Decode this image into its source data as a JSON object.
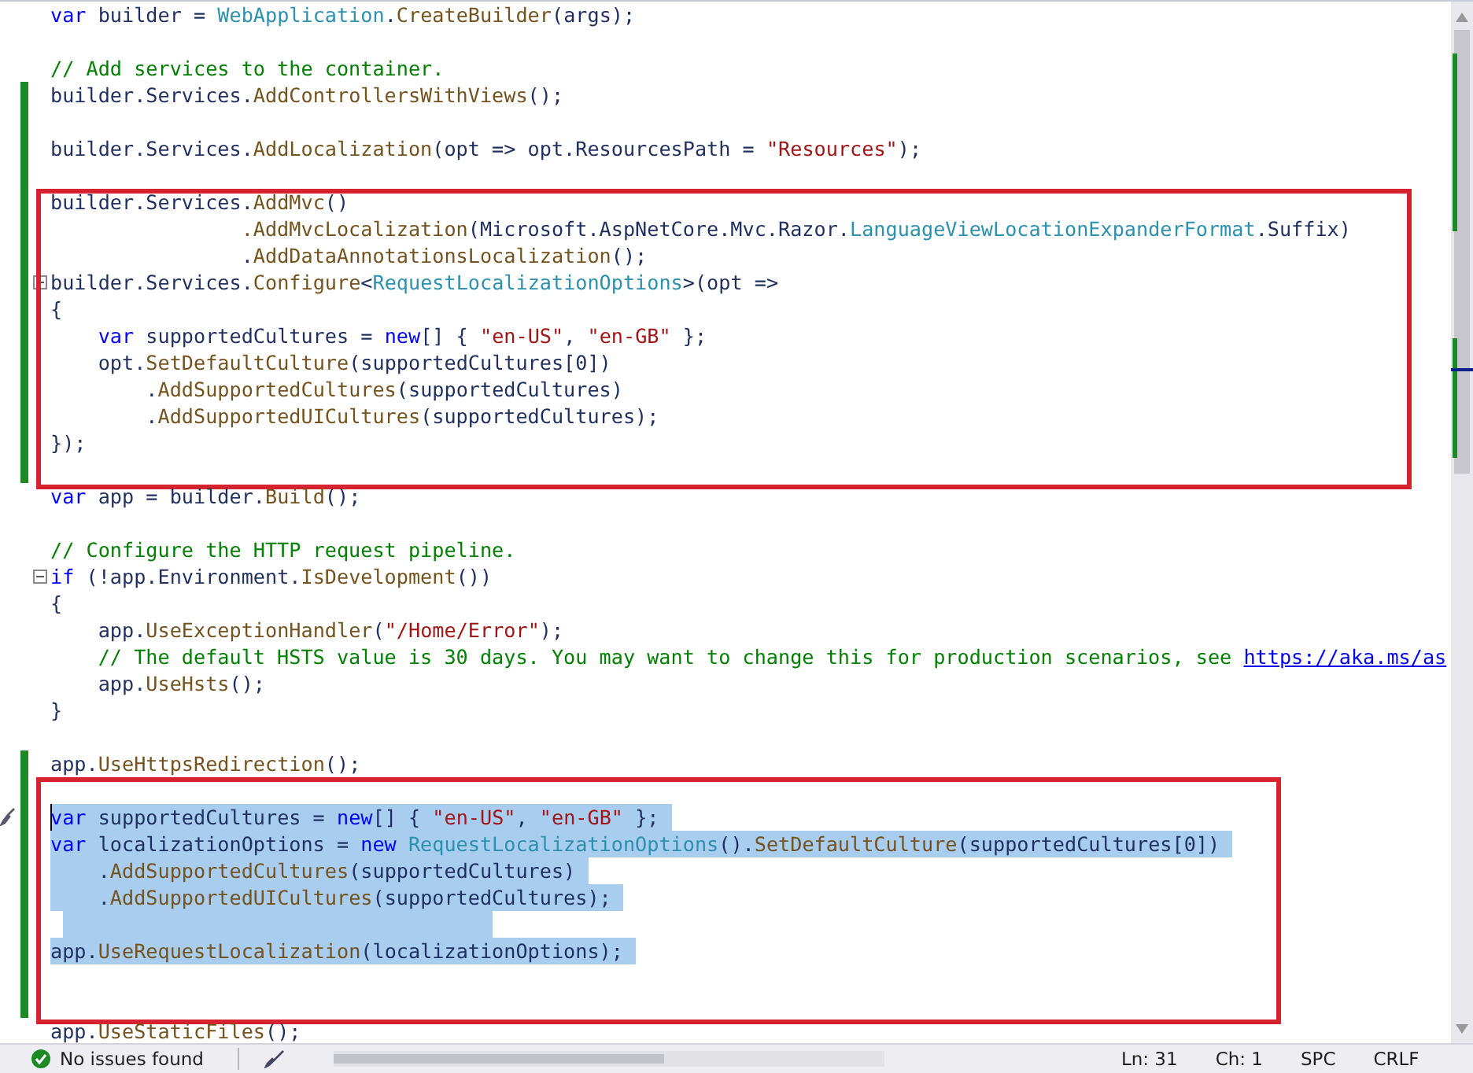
{
  "editor": {
    "blocks": [
      {
        "kind": "plain",
        "lines": [
          {
            "changed": false,
            "selected": false,
            "tokens": [
              {
                "kind": "keyword",
                "text": "var"
              },
              {
                "kind": "plain",
                "text": " builder = "
              },
              {
                "kind": "type",
                "text": "WebApplication"
              },
              {
                "kind": "plain",
                "text": "."
              },
              {
                "kind": "method",
                "text": "CreateBuilder"
              },
              {
                "kind": "plain",
                "text": "(args);"
              }
            ]
          },
          {
            "changed": false,
            "selected": false
          },
          {
            "changed": false,
            "selected": false,
            "tokens": [
              {
                "kind": "comment",
                "text": "// Add services to the container."
              }
            ]
          },
          {
            "changed": true,
            "selected": false,
            "tokens": [
              {
                "kind": "plain",
                "text": "builder.Services."
              },
              {
                "kind": "method",
                "text": "AddControllersWithViews"
              },
              {
                "kind": "plain",
                "text": "();"
              }
            ]
          },
          {
            "changed": true,
            "selected": false
          },
          {
            "changed": true,
            "selected": false,
            "tokens": [
              {
                "kind": "plain",
                "text": "builder.Services."
              },
              {
                "kind": "method",
                "text": "AddLocalization"
              },
              {
                "kind": "plain",
                "text": "(opt => opt.ResourcesPath = "
              },
              {
                "kind": "string",
                "text": "\"Resources\""
              },
              {
                "kind": "plain",
                "text": ");"
              }
            ]
          },
          {
            "changed": true,
            "selected": false
          }
        ]
      },
      {
        "kind": "annotated",
        "lines": [
          {
            "changed": true,
            "selected": false,
            "tokens": [
              {
                "kind": "plain",
                "text": "builder.Services."
              },
              {
                "kind": "method",
                "text": "AddMvc"
              },
              {
                "kind": "plain",
                "text": "()"
              }
            ]
          },
          {
            "changed": true,
            "selected": false,
            "tokens": [
              {
                "kind": "method",
                "text": "                .AddMvcLocalization"
              },
              {
                "kind": "plain",
                "text": "(Microsoft.AspNetCore.Mvc.Razor."
              },
              {
                "kind": "type",
                "text": "LanguageViewLocationExpanderFormat"
              },
              {
                "kind": "plain",
                "text": ".Suffix)"
              }
            ]
          },
          {
            "changed": true,
            "selected": false,
            "tokens": [
              {
                "kind": "plain",
                "text": "                ."
              },
              {
                "kind": "method",
                "text": "AddDataAnnotationsLocalization"
              },
              {
                "kind": "plain",
                "text": "();"
              }
            ]
          },
          {
            "changed": true,
            "selected": false,
            "fold": true,
            "tokens": [
              {
                "kind": "plain",
                "text": "builder.Services."
              },
              {
                "kind": "method",
                "text": "Configure"
              },
              {
                "kind": "plain",
                "text": "<"
              },
              {
                "kind": "type",
                "text": "RequestLocalizationOptions"
              },
              {
                "kind": "plain",
                "text": ">(opt =>"
              }
            ]
          },
          {
            "changed": true,
            "selected": false,
            "tokens": [
              {
                "kind": "plain",
                "text": "{"
              }
            ]
          },
          {
            "changed": true,
            "selected": false,
            "tokens": [
              {
                "kind": "keyword",
                "text": "    var"
              },
              {
                "kind": "plain",
                "text": " supportedCultures = "
              },
              {
                "kind": "keyword",
                "text": "new"
              },
              {
                "kind": "plain",
                "text": "[] { "
              },
              {
                "kind": "string",
                "text": "\"en-US\""
              },
              {
                "kind": "plain",
                "text": ", "
              },
              {
                "kind": "string",
                "text": "\"en-GB\""
              },
              {
                "kind": "plain",
                "text": " };"
              }
            ]
          },
          {
            "changed": true,
            "selected": false,
            "tokens": [
              {
                "kind": "plain",
                "text": "    opt."
              },
              {
                "kind": "method",
                "text": "SetDefaultCulture"
              },
              {
                "kind": "plain",
                "text": "(supportedCultures[0])"
              }
            ]
          },
          {
            "changed": true,
            "selected": false,
            "tokens": [
              {
                "kind": "plain",
                "text": "        ."
              },
              {
                "kind": "method",
                "text": "AddSupportedCultures"
              },
              {
                "kind": "plain",
                "text": "(supportedCultures)"
              }
            ]
          },
          {
            "changed": true,
            "selected": false,
            "tokens": [
              {
                "kind": "plain",
                "text": "        ."
              },
              {
                "kind": "method",
                "text": "AddSupportedUICultures"
              },
              {
                "kind": "plain",
                "text": "(supportedCultures);"
              }
            ]
          },
          {
            "changed": true,
            "selected": false,
            "tokens": [
              {
                "kind": "plain",
                "text": "});"
              }
            ]
          },
          {
            "changed": true,
            "selected": false
          }
        ]
      },
      {
        "kind": "plain",
        "lines": [
          {
            "changed": false,
            "selected": false,
            "tokens": [
              {
                "kind": "keyword",
                "text": "var"
              },
              {
                "kind": "plain",
                "text": " app = builder."
              },
              {
                "kind": "method",
                "text": "Build"
              },
              {
                "kind": "plain",
                "text": "();"
              }
            ]
          },
          {
            "changed": false,
            "selected": false
          },
          {
            "changed": false,
            "selected": false,
            "tokens": [
              {
                "kind": "comment",
                "text": "// Configure the HTTP request pipeline."
              }
            ]
          },
          {
            "changed": false,
            "selected": false,
            "fold": true,
            "tokens": [
              {
                "kind": "keyword",
                "text": "if"
              },
              {
                "kind": "plain",
                "text": " (!app.Environment."
              },
              {
                "kind": "method",
                "text": "IsDevelopment"
              },
              {
                "kind": "plain",
                "text": "())"
              }
            ]
          },
          {
            "changed": false,
            "selected": false,
            "tokens": [
              {
                "kind": "plain",
                "text": "{"
              }
            ]
          },
          {
            "changed": false,
            "selected": false,
            "tokens": [
              {
                "kind": "plain",
                "text": "    app."
              },
              {
                "kind": "method",
                "text": "UseExceptionHandler"
              },
              {
                "kind": "plain",
                "text": "("
              },
              {
                "kind": "string",
                "text": "\"/Home/Error\""
              },
              {
                "kind": "plain",
                "text": ");"
              }
            ]
          },
          {
            "changed": false,
            "selected": false,
            "tokens": [
              {
                "kind": "comment",
                "text": "    // The default HSTS value is 30 days. You may want to change this for production scenarios, see "
              },
              {
                "kind": "link",
                "text": "https://aka.ms/as"
              }
            ]
          },
          {
            "changed": false,
            "selected": false,
            "tokens": [
              {
                "kind": "plain",
                "text": "    app."
              },
              {
                "kind": "method",
                "text": "UseHsts"
              },
              {
                "kind": "plain",
                "text": "();"
              }
            ]
          },
          {
            "changed": false,
            "selected": false,
            "tokens": [
              {
                "kind": "plain",
                "text": "}"
              }
            ]
          },
          {
            "changed": false,
            "selected": false
          },
          {
            "changed": true,
            "selected": false,
            "tokens": [
              {
                "kind": "plain",
                "text": "app."
              },
              {
                "kind": "method",
                "text": "UseHttpsRedirection"
              },
              {
                "kind": "plain",
                "text": "();"
              }
            ]
          }
        ]
      },
      {
        "kind": "annotated",
        "lines": [
          {
            "changed": true,
            "selected": false
          },
          {
            "changed": true,
            "selected": true,
            "caret": true,
            "tokens": [
              {
                "kind": "keyword",
                "text": "var"
              },
              {
                "kind": "plain",
                "text": " supportedCultures = "
              },
              {
                "kind": "keyword",
                "text": "new"
              },
              {
                "kind": "plain",
                "text": "[] { "
              },
              {
                "kind": "string",
                "text": "\"en-US\""
              },
              {
                "kind": "plain",
                "text": ", "
              },
              {
                "kind": "string",
                "text": "\"en-GB\""
              },
              {
                "kind": "plain",
                "text": " };"
              }
            ]
          },
          {
            "changed": true,
            "selected": true,
            "tokens": [
              {
                "kind": "keyword",
                "text": "var"
              },
              {
                "kind": "plain",
                "text": " localizationOptions = "
              },
              {
                "kind": "keyword",
                "text": "new"
              },
              {
                "kind": "type",
                "text": " RequestLocalizationOptions"
              },
              {
                "kind": "plain",
                "text": "()."
              },
              {
                "kind": "method",
                "text": "SetDefaultCulture"
              },
              {
                "kind": "plain",
                "text": "(supportedCultures[0])"
              }
            ]
          },
          {
            "changed": true,
            "selected": true,
            "tokens": [
              {
                "kind": "plain",
                "text": "    ."
              },
              {
                "kind": "method",
                "text": "AddSupportedCultures"
              },
              {
                "kind": "plain",
                "text": "(supportedCultures)"
              }
            ]
          },
          {
            "changed": true,
            "selected": true,
            "tokens": [
              {
                "kind": "plain",
                "text": "    ."
              },
              {
                "kind": "method",
                "text": "AddSupportedUICultures"
              },
              {
                "kind": "plain",
                "text": "(supportedCultures);"
              }
            ]
          },
          {
            "changed": true,
            "selected": true
          },
          {
            "changed": true,
            "selected": true,
            "tokens": [
              {
                "kind": "plain",
                "text": "app."
              },
              {
                "kind": "method",
                "text": "UseRequestLocalization"
              },
              {
                "kind": "plain",
                "text": "(localizationOptions);"
              }
            ]
          },
          {
            "changed": true,
            "selected": false
          },
          {
            "changed": true,
            "selected": false
          }
        ]
      },
      {
        "kind": "plain",
        "lines": [
          {
            "changed": false,
            "selected": false,
            "tokens": [
              {
                "kind": "plain",
                "text": "app."
              },
              {
                "kind": "method",
                "text": "UseStaticFiles"
              },
              {
                "kind": "plain",
                "text": "();"
              }
            ]
          }
        ]
      }
    ]
  },
  "status_bar": {
    "issues": "No issues found",
    "line": "Ln: 31",
    "column": "Ch: 1",
    "whitespace": "SPC",
    "line_ending": "CRLF"
  }
}
